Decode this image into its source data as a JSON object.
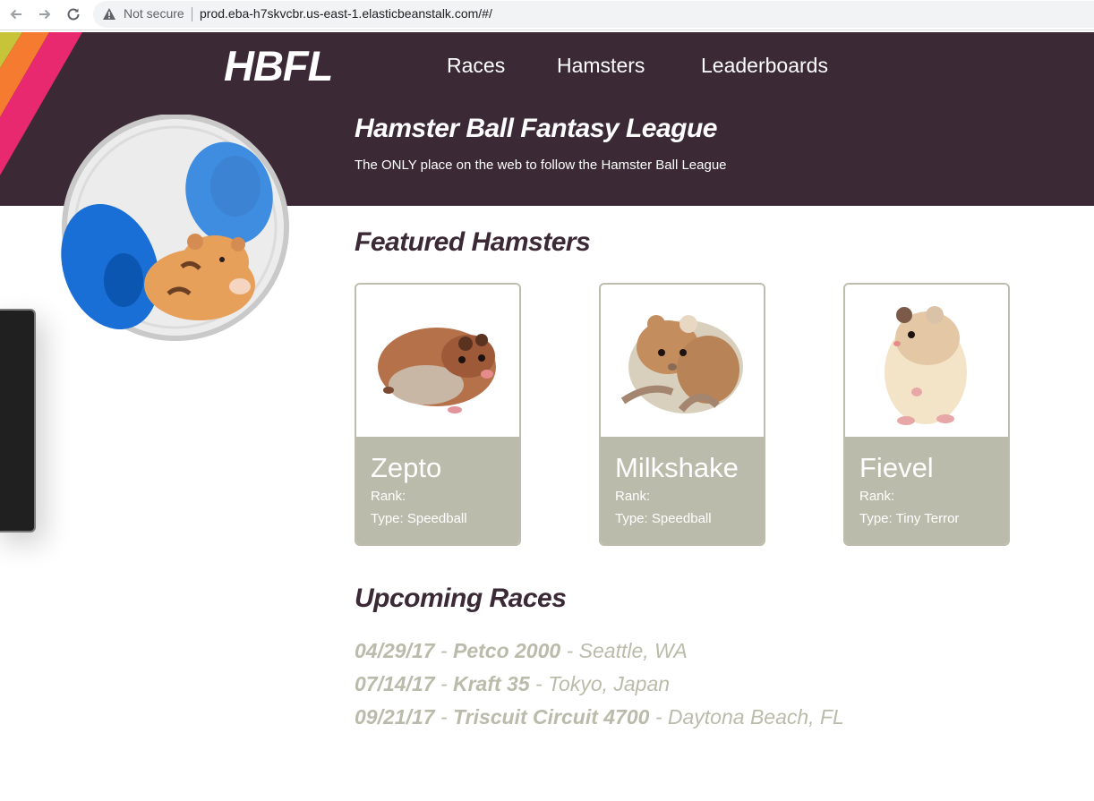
{
  "browser": {
    "back_icon": "arrow-left-icon",
    "forward_icon": "arrow-right-icon",
    "reload_icon": "reload-icon",
    "security_label": "Not secure",
    "url": "prod.eba-h7skvcbr.us-east-1.elasticbeanstalk.com/#/"
  },
  "header": {
    "logo": "HBFL",
    "nav": [
      "Races",
      "Hamsters",
      "Leaderboards"
    ],
    "title": "Hamster Ball Fantasy League",
    "subtitle": "The ONLY place on the web to follow the Hamster Ball League",
    "background_color": "#3b2a36",
    "stripe_colors": [
      "#c8c43a",
      "#f47b30",
      "#e8286f"
    ]
  },
  "featured": {
    "title": "Featured Hamsters",
    "cards": [
      {
        "name": "Zepto",
        "rank": "Rank:",
        "type": "Type: Speedball"
      },
      {
        "name": "Milkshake",
        "rank": "Rank:",
        "type": "Type: Speedball"
      },
      {
        "name": "Fievel",
        "rank": "Rank:",
        "type": "Type: Tiny Terror"
      }
    ]
  },
  "races": {
    "title": "Upcoming Races",
    "items": [
      {
        "date": "04/29/17",
        "name": "Petco 2000",
        "location": "Seattle, WA"
      },
      {
        "date": "07/14/17",
        "name": "Kraft 35",
        "location": "Tokyo, Japan"
      },
      {
        "date": "09/21/17",
        "name": "Triscuit Circuit 4700",
        "location": "Daytona Beach, FL"
      }
    ],
    "separator": " - "
  }
}
